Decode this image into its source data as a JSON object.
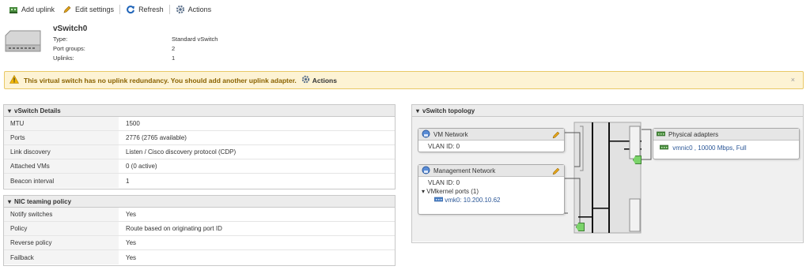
{
  "toolbar": {
    "add_uplink": "Add uplink",
    "edit_settings": "Edit settings",
    "refresh": "Refresh",
    "actions": "Actions"
  },
  "header": {
    "title": "vSwitch0",
    "fields": [
      {
        "key": "Type:",
        "value": "Standard vSwitch"
      },
      {
        "key": "Port groups:",
        "value": "2"
      },
      {
        "key": "Uplinks:",
        "value": "1"
      }
    ]
  },
  "alert": {
    "message": "This virtual switch has no uplink redundancy. You should add another uplink adapter.",
    "actions": "Actions",
    "close": "×"
  },
  "details": {
    "title": "vSwitch Details",
    "rows": [
      {
        "label": "MTU",
        "value": "1500"
      },
      {
        "label": "Ports",
        "value": "2776 (2765 available)"
      },
      {
        "label": "Link discovery",
        "value": "Listen / Cisco discovery protocol (CDP)"
      },
      {
        "label": "Attached VMs",
        "value": "0 (0 active)"
      },
      {
        "label": "Beacon interval",
        "value": "1"
      }
    ]
  },
  "teaming": {
    "title": "NIC teaming policy",
    "rows": [
      {
        "label": "Notify switches",
        "value": "Yes"
      },
      {
        "label": "Policy",
        "value": "Route based on originating port ID"
      },
      {
        "label": "Reverse policy",
        "value": "Yes"
      },
      {
        "label": "Failback",
        "value": "Yes"
      }
    ]
  },
  "topology": {
    "title": "vSwitch topology",
    "vm_network": {
      "name": "VM Network",
      "vlan": "VLAN ID: 0"
    },
    "mgmt_network": {
      "name": "Management Network",
      "vlan": "VLAN ID: 0",
      "vmk_ports": "VMkernel ports (1)",
      "vmk0": "vmk0: 10.200.10.62"
    },
    "physical": {
      "title": "Physical adapters",
      "nic": "vmnic0 , 10000 Mbps, Full"
    }
  },
  "colors": {
    "alert_bg": "#fdf3d4",
    "alert_text": "#8a6200",
    "link": "#2b5797",
    "uplink_green": "#7bd36a"
  }
}
